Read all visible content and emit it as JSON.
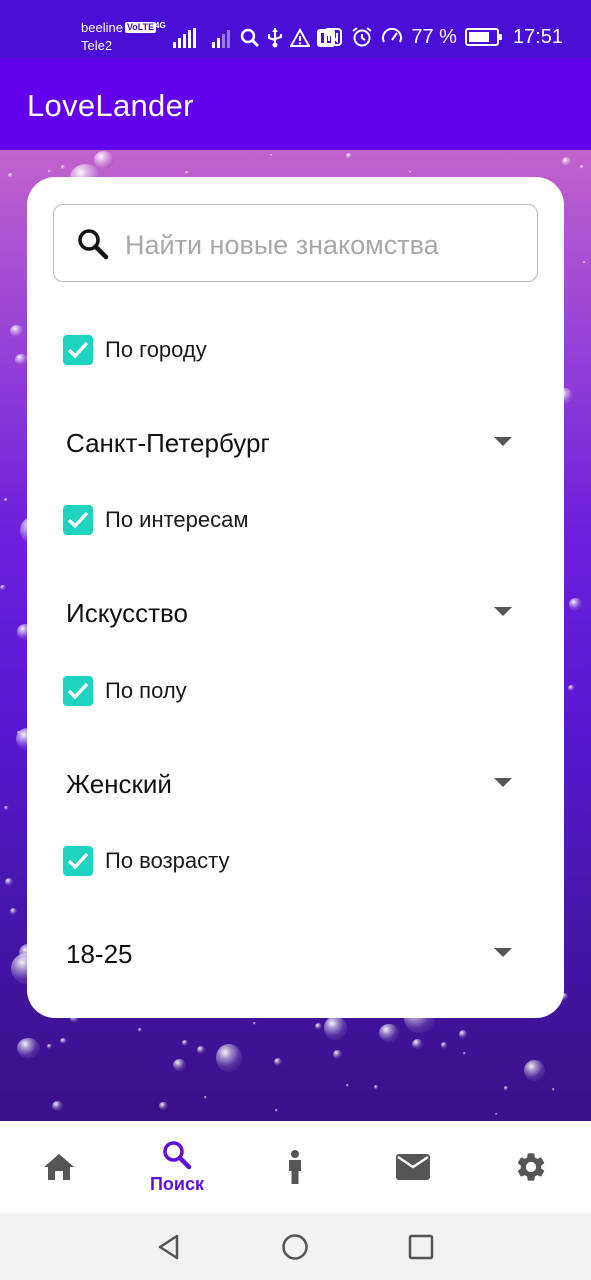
{
  "status_bar": {
    "carrier_1": "beeline",
    "volte": "VoLTE",
    "net_type": "4G",
    "carrier_2": "Tele2",
    "battery_percent": "77 %",
    "battery_level": 0.77,
    "time": "17:51"
  },
  "app_bar": {
    "title": "LoveLander"
  },
  "search": {
    "placeholder": "Найти новые знакомства",
    "value": ""
  },
  "filters": [
    {
      "label": "По городу",
      "checked": true,
      "dropdown_value": "Санкт-Петербург"
    },
    {
      "label": "По интересам",
      "checked": true,
      "dropdown_value": "Искусство"
    },
    {
      "label": "По полу",
      "checked": true,
      "dropdown_value": "Женский"
    },
    {
      "label": "По возрасту",
      "checked": true,
      "dropdown_value": "18-25"
    }
  ],
  "bottom_nav": {
    "items": [
      {
        "icon": "home-icon",
        "label": "",
        "active": false
      },
      {
        "icon": "search-icon",
        "label": "Поиск",
        "active": true
      },
      {
        "icon": "person-icon",
        "label": "",
        "active": false
      },
      {
        "icon": "mail-icon",
        "label": "",
        "active": false
      },
      {
        "icon": "gear-icon",
        "label": "",
        "active": false
      }
    ]
  },
  "colors": {
    "status_bar": "#4a0fd6",
    "app_bar": "#6200ee",
    "checkbox": "#1ed3c0",
    "nav_active": "#5b12d6",
    "nav_inactive": "#555555"
  }
}
